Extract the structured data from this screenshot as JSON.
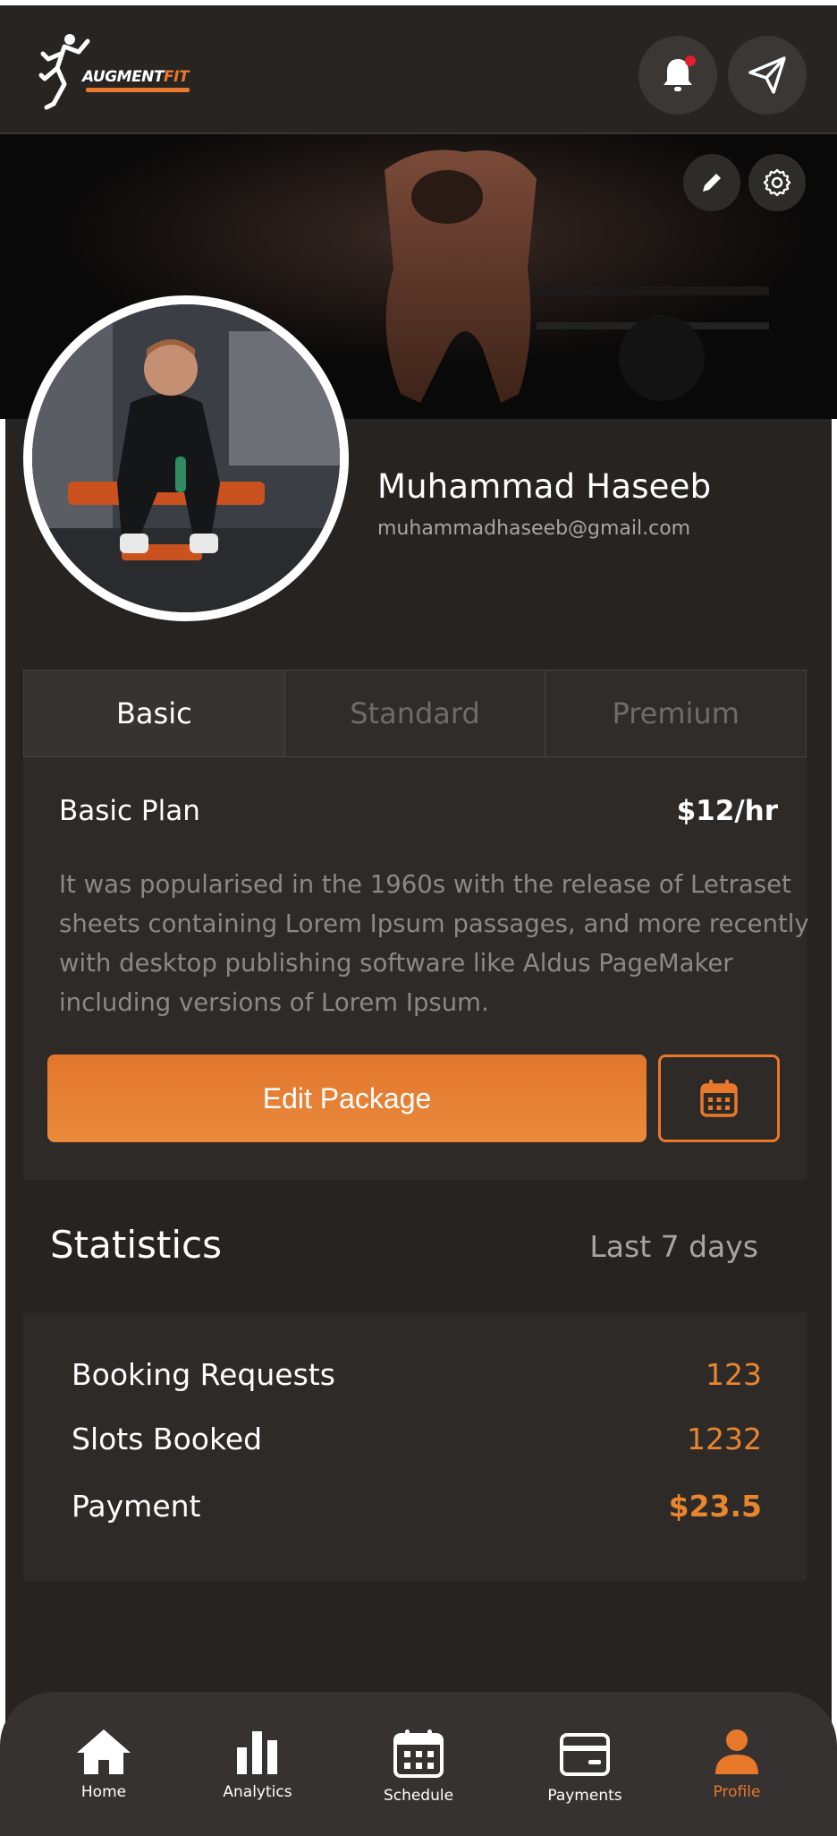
{
  "header": {
    "logo_text": "AUGMENT",
    "logo_text_accent": "FIT",
    "accent_color": "#e8782a"
  },
  "profile": {
    "name": "Muhammad Haseeb",
    "email": "muhammadhaseeb@gmail.com"
  },
  "plan": {
    "tabs": [
      {
        "label": "Basic",
        "active": true
      },
      {
        "label": "Standard",
        "active": false
      },
      {
        "label": "Premium",
        "active": false
      }
    ],
    "title": "Basic Plan",
    "price": "$12/hr",
    "description": "It was popularised in the 1960s with the release of Letraset sheets containing Lorem Ipsum passages, and more recently with desktop publishing software like Aldus PageMaker including versions of Lorem Ipsum.",
    "edit_label": "Edit Package"
  },
  "statistics": {
    "title": "Statistics",
    "range": "Last 7 days",
    "rows": [
      {
        "label": "Booking Requests",
        "value": "123"
      },
      {
        "label": "Slots Booked",
        "value": "1232"
      },
      {
        "label": "Payment",
        "value": "$23.5"
      }
    ]
  },
  "nav": {
    "items": [
      {
        "label": "Home",
        "icon": "home-icon"
      },
      {
        "label": "Analytics",
        "icon": "bar-chart-icon"
      },
      {
        "label": "Schedule",
        "icon": "calendar-icon"
      },
      {
        "label": "Payments",
        "icon": "wallet-icon"
      },
      {
        "label": "Profile",
        "icon": "user-icon",
        "active": true
      }
    ]
  }
}
